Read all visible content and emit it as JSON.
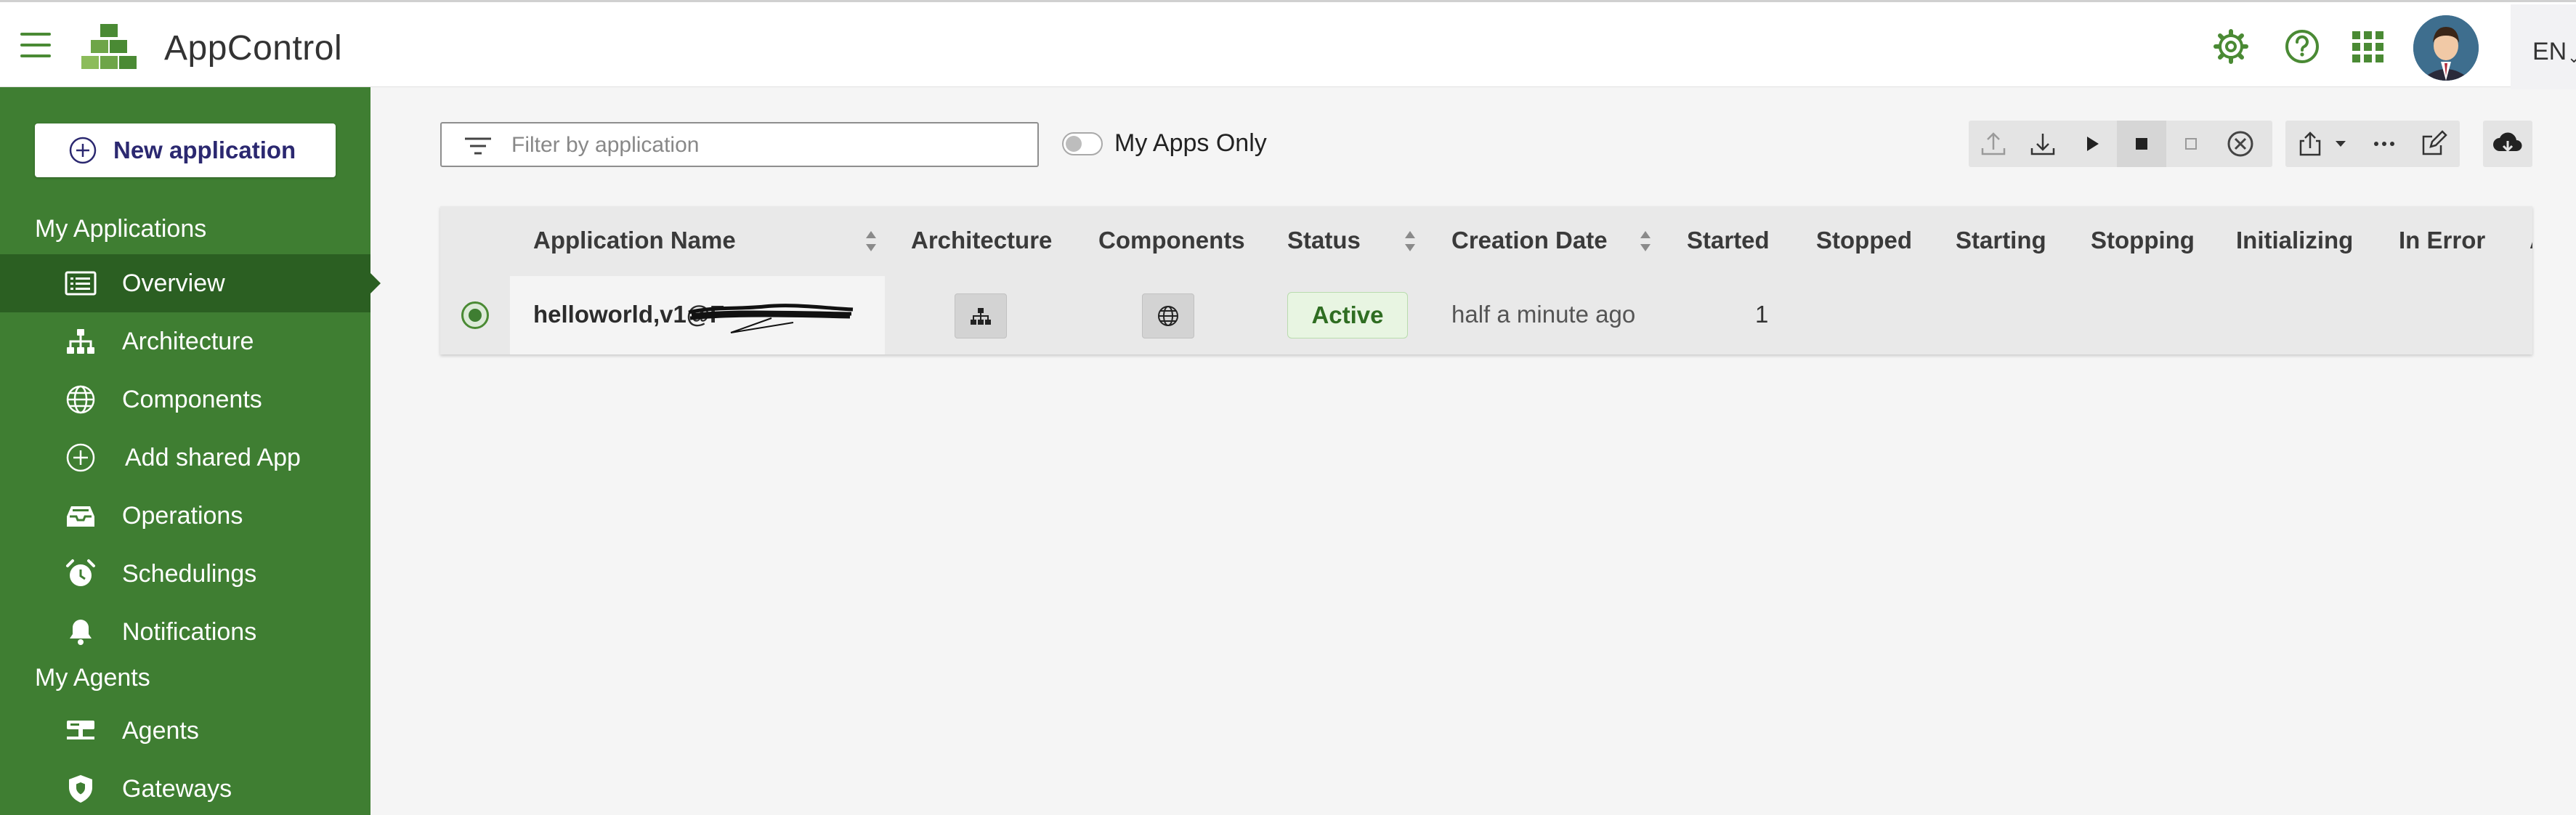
{
  "app": {
    "title": "AppControl",
    "language": "EN"
  },
  "sidebar": {
    "new_app_label": "New application",
    "section_my_apps": "My Applications",
    "section_my_agents": "My Agents",
    "items": [
      {
        "label": "Overview",
        "icon": "list-icon",
        "active": true
      },
      {
        "label": "Architecture",
        "icon": "sitemap-icon"
      },
      {
        "label": "Components",
        "icon": "globe-icon"
      },
      {
        "label": "Add shared App",
        "icon": "plus-circle-icon"
      },
      {
        "label": "Operations",
        "icon": "inbox-icon"
      },
      {
        "label": "Schedulings",
        "icon": "alarm-clock-icon"
      },
      {
        "label": "Notifications",
        "icon": "bell-icon"
      }
    ],
    "agent_items": [
      {
        "label": "Agents",
        "icon": "server-icon"
      },
      {
        "label": "Gateways",
        "icon": "shield-icon"
      }
    ]
  },
  "toolbar": {
    "filter_placeholder": "Filter by application",
    "my_apps_only_label": "My Apps Only",
    "my_apps_only": false
  },
  "table": {
    "columns": [
      "Application Name",
      "Architecture",
      "Components",
      "Status",
      "Creation Date",
      "Started",
      "Stopped",
      "Starting",
      "Stopping",
      "Initializing",
      "In Error",
      "A"
    ],
    "rows": [
      {
        "name": "helloworld,v1@F",
        "status": "Active",
        "creation_date": "half a minute ago",
        "started": "1",
        "selected": true
      }
    ]
  },
  "colors": {
    "brand_green": "#3f7e32",
    "sidebar_active": "#2b5f22",
    "status_active_bg": "#e8f5e2"
  }
}
